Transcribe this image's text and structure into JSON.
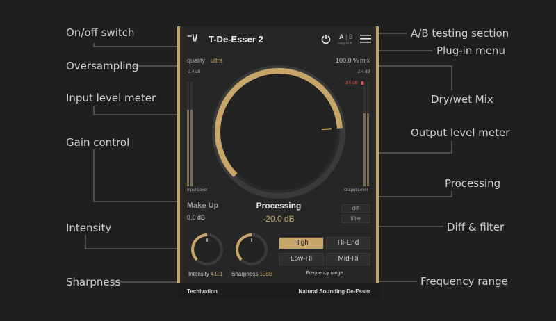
{
  "callouts": {
    "on_off": "On/off switch",
    "oversampling": "Oversampling",
    "input_meter": "Input level meter",
    "gain": "Gain control",
    "intensity": "Intensity",
    "sharpness": "Sharpness",
    "ab": "A/B testing section",
    "menu": "Plug-in menu",
    "drywet": "Dry/wet Mix",
    "output_meter": "Output level meter",
    "processing": "Processing",
    "diff_filter": "Diff & filter",
    "freq_range": "Frequency range"
  },
  "plugin": {
    "logo": "⁻\\/",
    "title": "T-De-Esser 2",
    "ab": {
      "a": "A",
      "sep": "|",
      "b": "B",
      "sub": "copy to B"
    },
    "quality_label": "quality",
    "quality_value": "ultra",
    "mix_value": "100.0 %",
    "mix_label": "mix",
    "input_db": "-2.4 dB",
    "output_db": "-2.4 dB",
    "reduction_db": "-3.5 dB",
    "input_level_label": "Input Level",
    "output_level_label": "Output Level",
    "makeup_label": "Make Up",
    "makeup_value": "0.0 dB",
    "processing_label": "Processing",
    "processing_value": "-20.0 dB",
    "processing_fraction": 0.82,
    "diff": "diff",
    "filter": "filter",
    "intensity_label": "Intensity",
    "intensity_value": "4.0:1",
    "sharpness_label": "Sharpness",
    "sharpness_value": "10dB",
    "freq_buttons": [
      "High",
      "Hi-End",
      "Low-Hi",
      "Mid-Hi"
    ],
    "freq_active": "High",
    "freq_range_label": "Frequency range",
    "footer_left": "Techivation",
    "footer_right": "Natural Sounding De-Esser"
  },
  "colors": {
    "accent": "#c8a66a",
    "panel": "#262626",
    "background": "#1f1f1f",
    "red": "#e0553f"
  }
}
